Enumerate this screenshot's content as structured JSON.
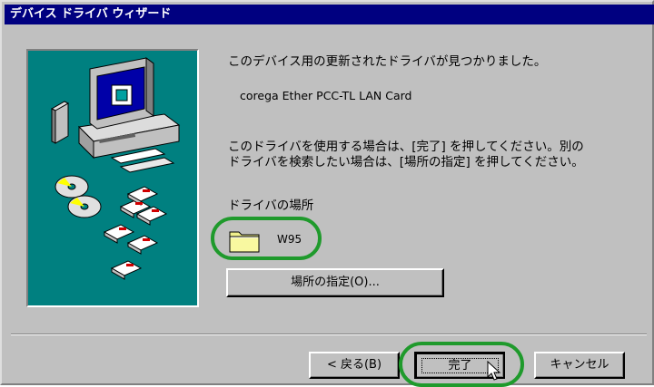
{
  "window": {
    "title": "デバイス ドライバ ウィザード"
  },
  "content": {
    "found_message": "このデバイス用の更新されたドライバが見つかりました。",
    "device_name": "corega Ether PCC-TL LAN Card",
    "instruction_line1": "このドライバを使用する場合は、[完了] を押してください。別の",
    "instruction_line2": "ドライバを検索したい場合は、[場所の指定] を押してください。",
    "location_label": "ドライバの場所",
    "folder_name": "W95",
    "location_button": "場所の指定(O)..."
  },
  "footer": {
    "back_button": "< 戻る(B)",
    "finish_button": "完了",
    "cancel_button": "キャンセル"
  },
  "colors": {
    "illustration_bg": "#008080",
    "highlight": "#1f9a2c",
    "titlebar": "#000080"
  }
}
